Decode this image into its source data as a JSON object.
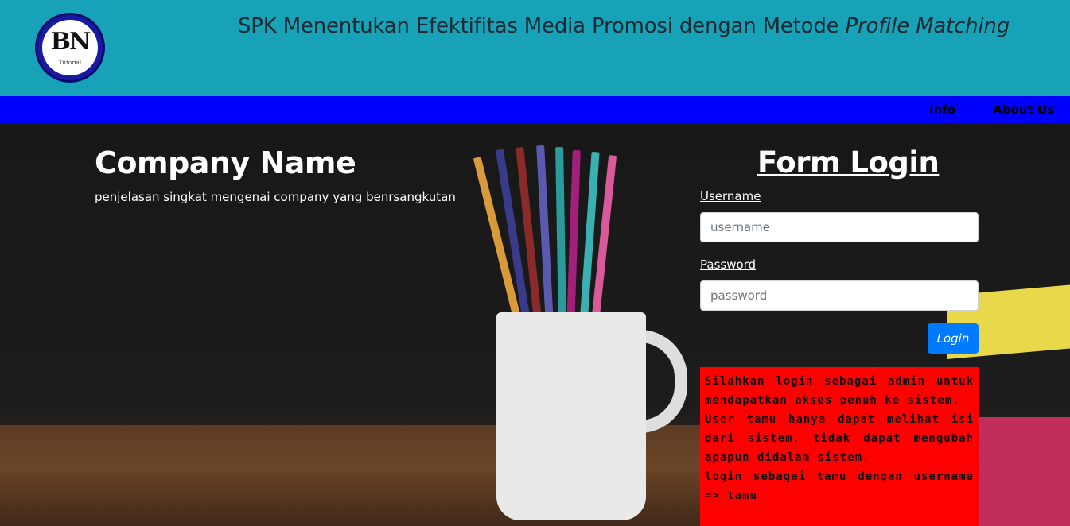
{
  "header": {
    "logo_text": "BN",
    "logo_sub": "Tutorial",
    "title_main": "SPK Menentukan Efektifitas Media Promosi dengan Metode ",
    "title_italic": "Profile Matching"
  },
  "nav": {
    "items": [
      {
        "label": "Info"
      },
      {
        "label": "About Us"
      }
    ]
  },
  "hero": {
    "company_name": "Company Name",
    "company_desc": "penjelasan singkat mengenai company yang benrsangkutan"
  },
  "form": {
    "title": "Form Login",
    "username_label": "Username",
    "username_placeholder": "username",
    "password_label": "Password",
    "password_placeholder": "password",
    "login_label": "Login"
  },
  "info": {
    "line1": "Silahkan login sebagai admin untuk mendapatkan akses penuh ke sistem.",
    "line2": "User tamu hanya dapat melihat isi dari sistem, tidak dapat mengubah apapun didalam sistem.",
    "line3": "login sebagai tamu dengan username => tamu"
  },
  "colors": {
    "header_bg": "#17a2b8",
    "nav_bg": "#0000ff",
    "button_bg": "#007bff",
    "info_bg": "#ff0000"
  }
}
